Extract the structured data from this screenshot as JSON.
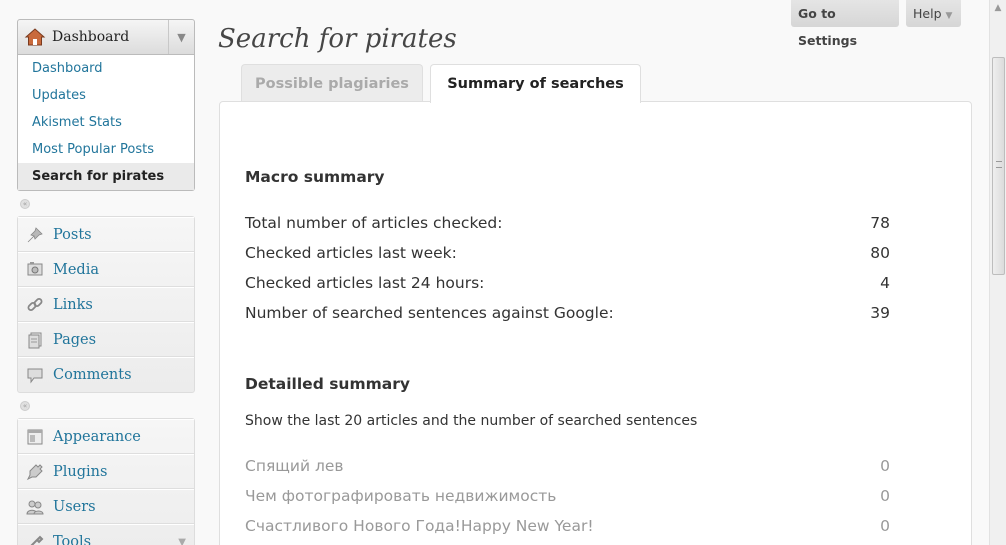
{
  "top_buttons": {
    "settings": "Go to Settings",
    "help": "Help"
  },
  "sidebar": {
    "dashboard_head": "Dashboard",
    "dashboard_sub": [
      "Dashboard",
      "Updates",
      "Akismet Stats",
      "Most Popular Posts",
      "Search for pirates"
    ],
    "group1": [
      "Posts",
      "Media",
      "Links",
      "Pages",
      "Comments"
    ],
    "group2": [
      "Appearance",
      "Plugins",
      "Users",
      "Tools"
    ]
  },
  "page": {
    "title": "Search for pirates",
    "tabs": [
      "Possible plagiaries",
      "Summary of searches"
    ]
  },
  "macro": {
    "heading": "Macro summary",
    "rows": [
      {
        "label": "Total number of articles checked:",
        "value": "78"
      },
      {
        "label": "Checked articles last week:",
        "value": "80"
      },
      {
        "label": "Checked articles last 24 hours:",
        "value": "4"
      },
      {
        "label": "Number of searched sentences against Google:",
        "value": "39"
      }
    ]
  },
  "detailed": {
    "heading": "Detailled summary",
    "description": "Show the last 20 articles and the number of searched sentences",
    "rows": [
      {
        "label": "Спящий лев",
        "value": "0"
      },
      {
        "label": "Чем фотографировать недвижимость",
        "value": "0"
      },
      {
        "label": "Счастливого Нового Года!Happy New Year!",
        "value": "0"
      }
    ]
  }
}
